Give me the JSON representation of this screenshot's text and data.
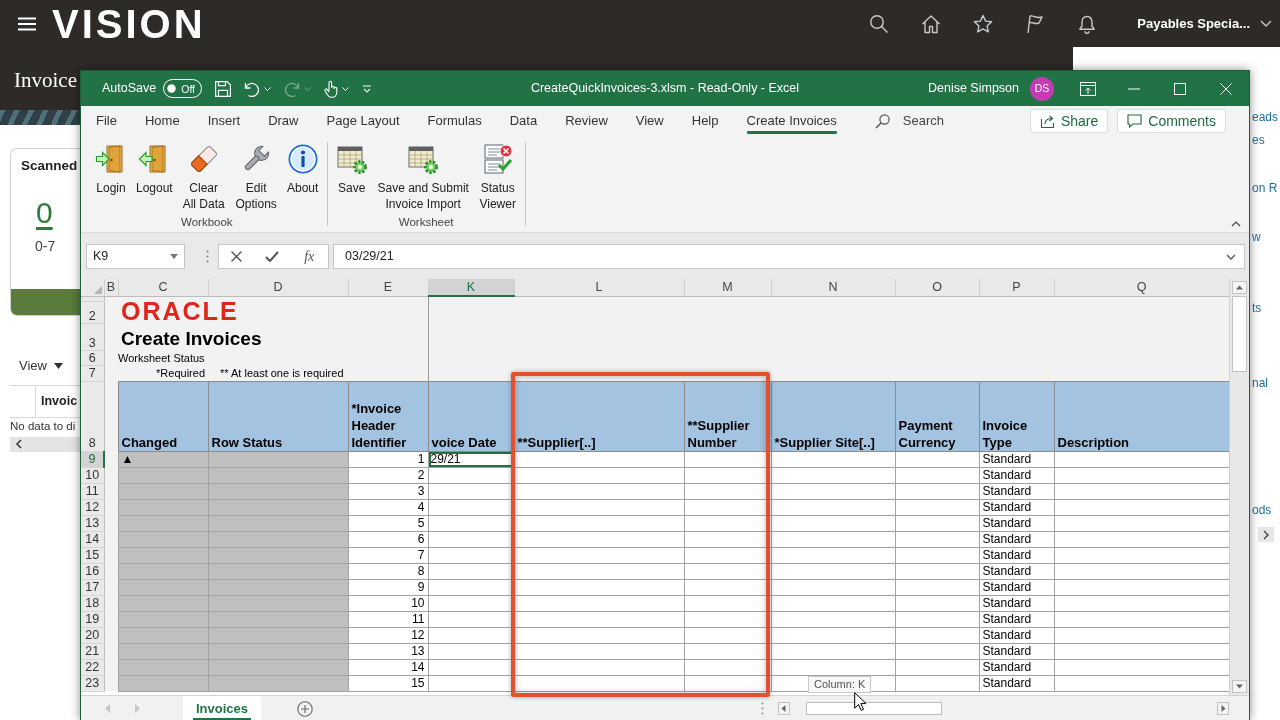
{
  "header": {
    "logo": "VISION",
    "user_menu": "Payables Specia..."
  },
  "page": {
    "title": "Invoice",
    "card": {
      "title": "Scanned",
      "count": "0",
      "range": "0-7"
    },
    "view_menu": "View",
    "table": {
      "column_1": "Invoic",
      "empty_text": "No data to di"
    }
  },
  "side_panel": {
    "links": [
      "eads",
      "es",
      "on R",
      "w",
      "ts",
      "nal",
      "ods"
    ]
  },
  "excel": {
    "window": {
      "title": "CreateQuickInvoices-3.xlsm - Read-Only - Excel",
      "user": "Denise Simpson",
      "avatar": "DS"
    },
    "autosave": {
      "label": "AutoSave",
      "on": false,
      "state_text": "Off"
    },
    "quick_access": [
      {
        "kind": "save",
        "disabled": false
      },
      {
        "kind": "undo",
        "disabled": false
      },
      {
        "kind": "redo",
        "disabled": true
      },
      {
        "kind": "touch",
        "disabled": false
      },
      {
        "kind": "customize",
        "disabled": false
      }
    ],
    "tabs": [
      {
        "label": "File",
        "selected": false
      },
      {
        "label": "Home",
        "selected": false
      },
      {
        "label": "Insert",
        "selected": false
      },
      {
        "label": "Draw",
        "selected": false
      },
      {
        "label": "Page Layout",
        "selected": false
      },
      {
        "label": "Formulas",
        "selected": false
      },
      {
        "label": "Data",
        "selected": false
      },
      {
        "label": "Review",
        "selected": false
      },
      {
        "label": "View",
        "selected": false
      },
      {
        "label": "Help",
        "selected": false
      },
      {
        "label": "Create Invoices",
        "selected": true
      }
    ],
    "search": {
      "placeholder": "Search"
    },
    "share_button": "Share",
    "comments_button": "Comments",
    "ribbon_groups": [
      {
        "label": "Workbook",
        "buttons": [
          {
            "kind": "login",
            "label": "Login"
          },
          {
            "kind": "logout",
            "label": "Logout"
          },
          {
            "kind": "eraser",
            "label": "Clear All Data"
          },
          {
            "kind": "wrench",
            "label": "Edit Options"
          },
          {
            "kind": "info",
            "label": "About"
          }
        ]
      },
      {
        "label": "Worksheet",
        "buttons": [
          {
            "kind": "sheet_gear",
            "label": "Save"
          },
          {
            "kind": "sheet_gear",
            "label": "Save and Submit Invoice Import"
          },
          {
            "kind": "status",
            "label": "Status Viewer"
          }
        ]
      }
    ],
    "formula_bar": {
      "name_box": "K9",
      "function_label": "fx",
      "formula": "03/29/21"
    },
    "columns": [
      {
        "label": "B",
        "selected": false
      },
      {
        "label": "C",
        "selected": false
      },
      {
        "label": "D",
        "selected": false
      },
      {
        "label": "E",
        "selected": false
      },
      {
        "label": "K",
        "selected": true
      },
      {
        "label": "L",
        "selected": false
      },
      {
        "label": "M",
        "selected": false
      },
      {
        "label": "N",
        "selected": false
      },
      {
        "label": "O",
        "selected": false
      },
      {
        "label": "P",
        "selected": false
      },
      {
        "label": "Q",
        "selected": false
      }
    ],
    "banner": {
      "rows": [
        "2",
        "3",
        "6",
        "7"
      ],
      "logo": "ORACLE",
      "title": "Create Invoices",
      "status_label": "Worksheet Status",
      "required_note": "*Required",
      "one_required_note": "** At least one is required"
    },
    "header_row": {
      "number": "8",
      "cells": [
        "Changed",
        "Row Status",
        "*Invoice Header Identifier",
        "voice Date",
        "**Supplier[..]",
        "**Supplier Number",
        "*Supplier Site[..]",
        "Payment Currency",
        "Invoice Type",
        "Description"
      ]
    },
    "rows": [
      {
        "number": "9",
        "selected": true,
        "changed": "▲",
        "identifier": "1",
        "invoice_date": "29/21",
        "invoice_type": "Standard"
      },
      {
        "number": "10",
        "selected": false,
        "identifier": "2",
        "invoice_type": "Standard"
      },
      {
        "number": "11",
        "selected": false,
        "identifier": "3",
        "invoice_type": "Standard"
      },
      {
        "number": "12",
        "selected": false,
        "identifier": "4",
        "invoice_type": "Standard"
      },
      {
        "number": "13",
        "selected": false,
        "identifier": "5",
        "invoice_type": "Standard"
      },
      {
        "number": "14",
        "selected": false,
        "identifier": "6",
        "invoice_type": "Standard"
      },
      {
        "number": "15",
        "selected": false,
        "identifier": "7",
        "invoice_type": "Standard"
      },
      {
        "number": "16",
        "selected": false,
        "identifier": "8",
        "invoice_type": "Standard"
      },
      {
        "number": "17",
        "selected": false,
        "identifier": "9",
        "invoice_type": "Standard"
      },
      {
        "number": "18",
        "selected": false,
        "identifier": "10",
        "invoice_type": "Standard"
      },
      {
        "number": "19",
        "selected": false,
        "identifier": "11",
        "invoice_type": "Standard"
      },
      {
        "number": "20",
        "selected": false,
        "identifier": "12",
        "invoice_type": "Standard"
      },
      {
        "number": "21",
        "selected": false,
        "identifier": "13",
        "invoice_type": "Standard"
      },
      {
        "number": "22",
        "selected": false,
        "identifier": "14",
        "invoice_type": "Standard"
      },
      {
        "number": "23",
        "selected": false,
        "identifier": "15",
        "invoice_type": "Standard"
      }
    ],
    "sheet_tabs": [
      {
        "label": "Invoices",
        "selected": true
      }
    ],
    "tooltip": "Column: K"
  }
}
